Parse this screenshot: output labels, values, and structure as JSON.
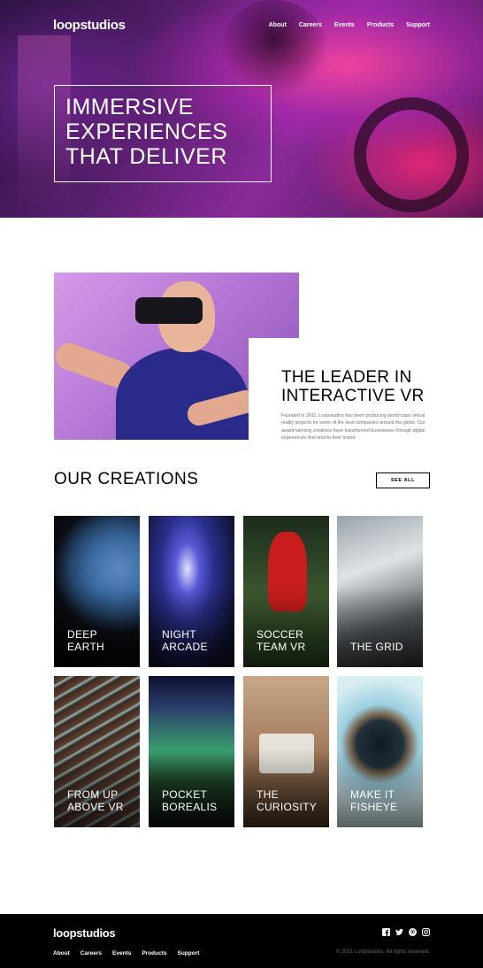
{
  "header": {
    "logo": "loopstudios",
    "nav": [
      "About",
      "Careers",
      "Events",
      "Products",
      "Support"
    ]
  },
  "hero": {
    "lines": [
      "IMMERSIVE",
      "EXPERIENCES",
      "THAT DELIVER"
    ]
  },
  "about": {
    "title_lines": [
      "THE LEADER IN",
      "INTERACTIVE VR"
    ],
    "text": "Founded in 2011, Loopstudios has been producing world-class virtual reality projects for some of the best companies around the globe. Our award-winning creations have transformed businesses through digital experiences that bind to their brand."
  },
  "creations": {
    "title": "OUR CREATIONS",
    "see_all": "SEE ALL",
    "items": [
      {
        "line1": "DEEP",
        "line2": "EARTH"
      },
      {
        "line1": "NIGHT",
        "line2": "ARCADE"
      },
      {
        "line1": "SOCCER",
        "line2": "TEAM VR"
      },
      {
        "line1": "",
        "line2": "THE GRID"
      },
      {
        "line1": "FROM UP",
        "line2": "ABOVE VR"
      },
      {
        "line1": "POCKET",
        "line2": "BOREALIS"
      },
      {
        "line1": "THE",
        "line2": "CURIOSITY"
      },
      {
        "line1": "MAKE IT",
        "line2": "FISHEYE"
      }
    ]
  },
  "footer": {
    "logo": "loopstudios",
    "nav": [
      "About",
      "Careers",
      "Events",
      "Products",
      "Support"
    ],
    "social_icons": [
      "facebook-icon",
      "twitter-icon",
      "pinterest-icon",
      "instagram-icon"
    ],
    "copyright": "© 2021 Loopstudios. All rights reserved."
  }
}
